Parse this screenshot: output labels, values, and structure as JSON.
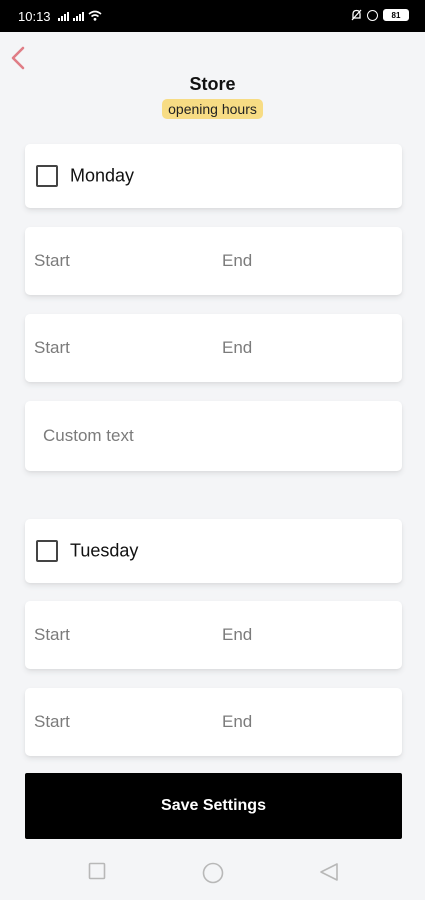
{
  "status_bar": {
    "time": "10:13",
    "battery": "81"
  },
  "header": {
    "title": "Store",
    "subtitle": "opening hours"
  },
  "days": [
    {
      "name": "Monday",
      "checked": false
    },
    {
      "name": "Tuesday",
      "checked": false
    }
  ],
  "fields": {
    "start_placeholder": "Start",
    "end_placeholder": "End",
    "custom_placeholder": "Custom text"
  },
  "actions": {
    "save_label": "Save Settings"
  },
  "colors": {
    "accent_back": "#e07d86",
    "badge": "#f7dc84",
    "button": "#000000"
  },
  "icons": [
    "back-arrow-icon",
    "checkbox-icon",
    "nav-square-icon",
    "nav-circle-icon",
    "nav-triangle-icon"
  ]
}
